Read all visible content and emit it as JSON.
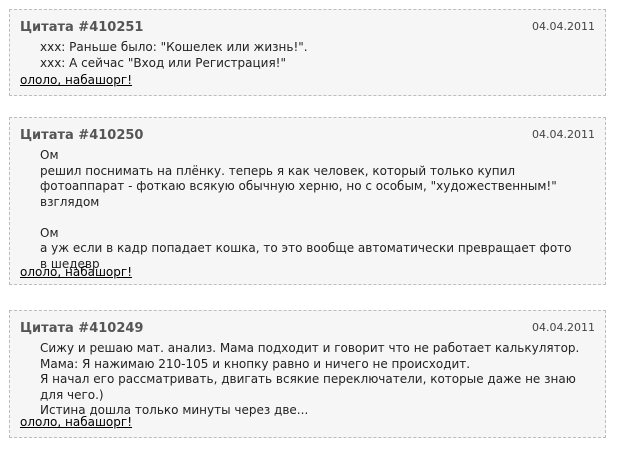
{
  "quotes": [
    {
      "title": "Цитата #410251",
      "date": "04.04.2011",
      "lines": [
        "xxx: Раньше было: \"Кошелек или жизнь!\".",
        "xxx: А сейчас \"Вход или Регистрация!\""
      ],
      "link": "ололо, набашорг!"
    },
    {
      "title": "Цитата #410250",
      "date": "04.04.2011",
      "lines": [
        "Ом",
        "решил поснимать на плёнку. теперь я как человек, который только купил",
        "фотоаппарат - фоткаю всякую обычную херню, но с особым, \"художественным!\"",
        "взглядом",
        "",
        "Ом",
        "а уж если в кадр попадает кошка, то это вообще автоматически превращает фото",
        "в шедевр"
      ],
      "link": "ололо, набашорг!"
    },
    {
      "title": "Цитата #410249",
      "date": "04.04.2011",
      "lines": [
        "Сижу и решаю мат. анализ. Мама подходит и говорит что не работает калькулятор.",
        "Мама: Я нажимаю 210-105 и кнопку равно и ничего не происходит.",
        "Я начал его рассматривать, двигать всякие переключатели, которые даже не знаю",
        "для чего.)",
        "Истина дошла только минуты через две..."
      ],
      "link": "ололо, набашорг!"
    }
  ]
}
